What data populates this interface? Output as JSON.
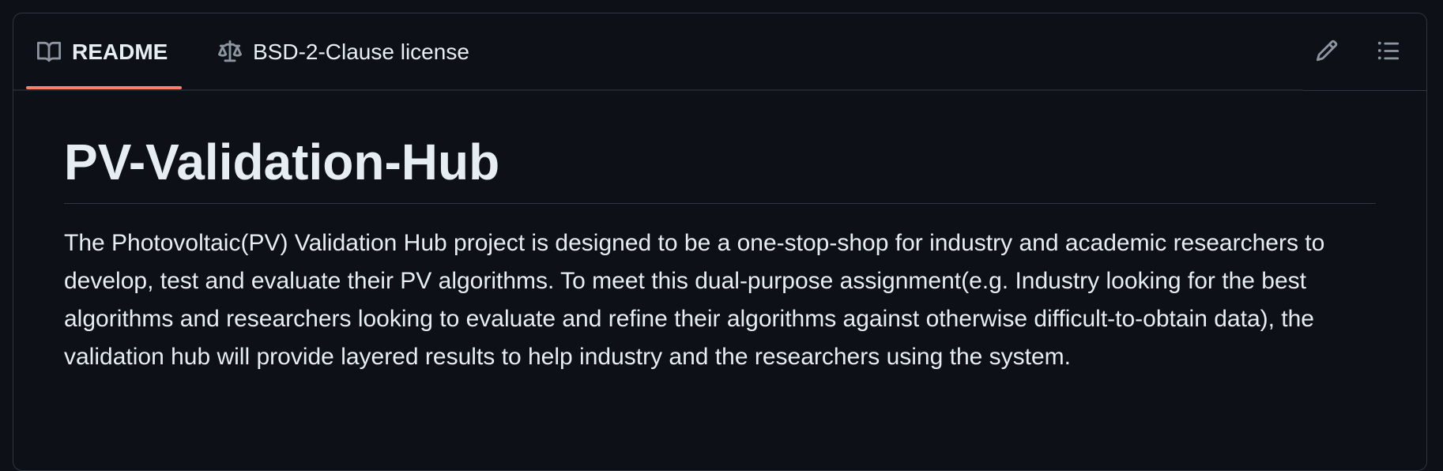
{
  "tabs": {
    "readme_label": "README",
    "license_label": "BSD-2-Clause license"
  },
  "icons": {
    "readme": "book-icon",
    "license": "law-scale-icon",
    "edit": "pencil-icon",
    "outline": "list-icon"
  },
  "colors": {
    "background": "#0d1117",
    "border": "#30363d",
    "text": "#e6edf3",
    "muted_icon": "#8d96a0",
    "active_tab_underline": "#f78166"
  },
  "readme": {
    "title": "PV-Validation-Hub",
    "paragraph": "The Photovoltaic(PV) Validation Hub project is designed to be a one-stop-shop for industry and academic researchers to develop, test and evaluate their PV algorithms. To meet this dual-purpose assignment(e.g. Industry looking for the best algorithms and researchers looking to evaluate and refine their algorithms against otherwise difficult-to-obtain data), the validation hub will provide layered results to help industry and the researchers using the system."
  }
}
